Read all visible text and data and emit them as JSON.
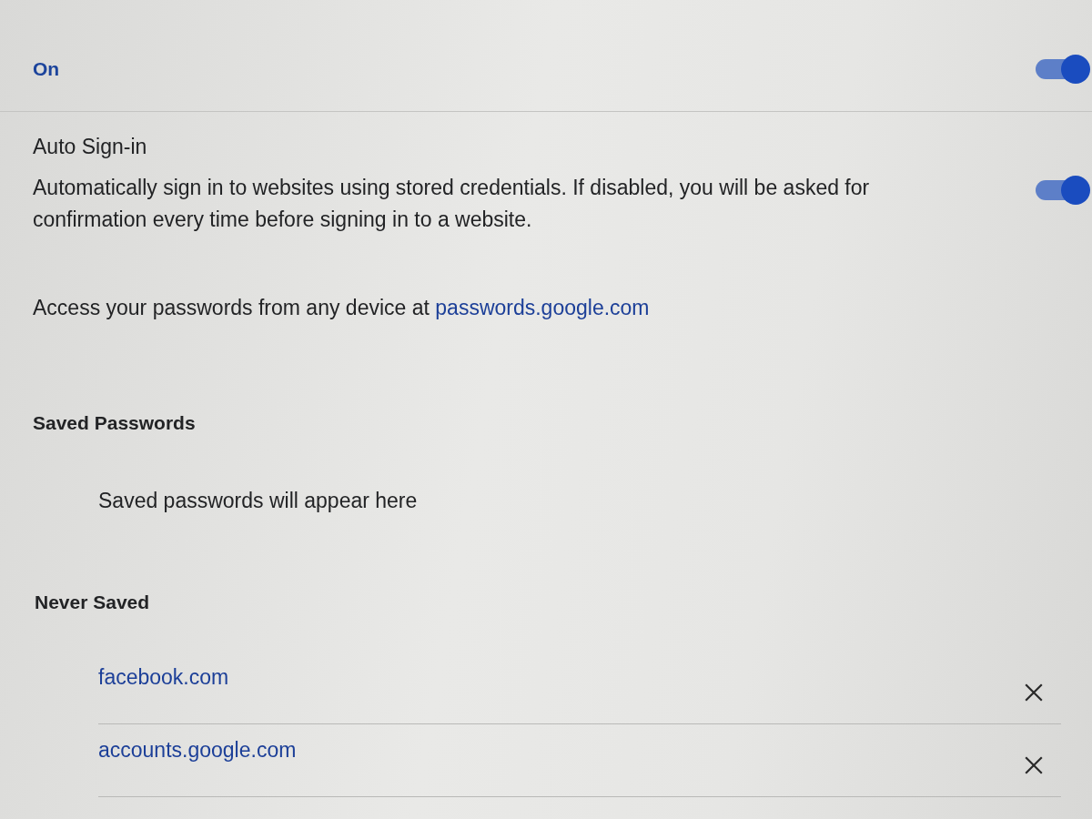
{
  "master_toggle": {
    "label": "On",
    "on": true
  },
  "auto_signin": {
    "title": "Auto Sign-in",
    "description": "Automatically sign in to websites using stored credentials. If disabled, you will be asked for confirmation every time before signing in to a website.",
    "on": true
  },
  "access_note": {
    "text": "Access your passwords from any device at",
    "link": "passwords.google.com"
  },
  "saved_passwords": {
    "heading": "Saved Passwords",
    "empty_message": "Saved passwords will appear here"
  },
  "never_saved": {
    "heading": "Never Saved",
    "sites": [
      {
        "site": "facebook.com"
      },
      {
        "site": "accounts.google.com"
      }
    ]
  }
}
